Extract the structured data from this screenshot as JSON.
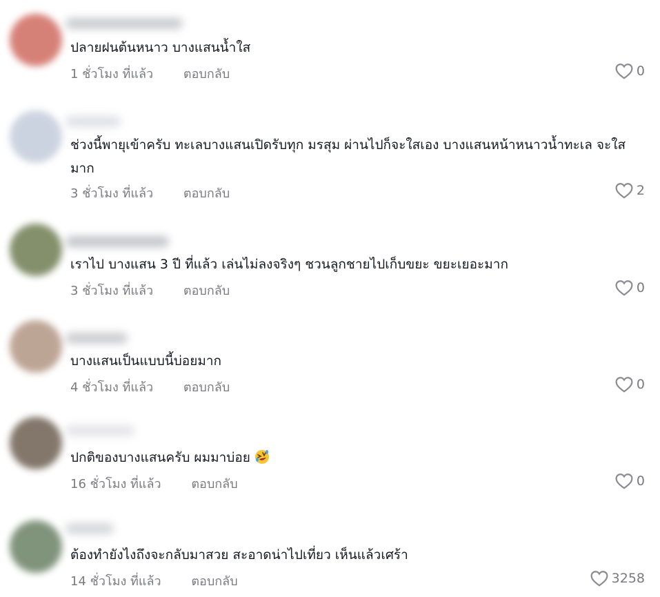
{
  "comments": [
    {
      "text": "ปลายฝนต้นหนาว บางแสนน้ำใส",
      "time": "1 ชั่วโมง ที่แล้ว",
      "reply_label": "ตอบกลับ",
      "likes": "0",
      "avatar_color": "#c9574a"
    },
    {
      "text": "ช่วงนี้พายุเข้าครับ ทะเลบางแสนเปิดรับทุก มรสุม ผ่านไปก็จะใสเอง บางแสนหน้าหนาวน้ำทะเล จะใสมาก",
      "time": "3 ชั่วโมง ที่แล้ว",
      "reply_label": "ตอบกลับ",
      "likes": "2",
      "avatar_color": "#bcc5d6"
    },
    {
      "text": "เราไป บางแสน 3 ปี ที่แล้ว เล่นไม่ลงจริงๆ ชวนลูกชายไปเก็บขยะ ขยะเยอะมาก",
      "time": "3 ชั่วโมง ที่แล้ว",
      "reply_label": "ตอบกลับ",
      "likes": "0",
      "avatar_color": "#5b6b3a"
    },
    {
      "text": "บางแสนเป็นแบบนี้บ่อยมาก",
      "time": "4 ชั่วโมง ที่แล้ว",
      "reply_label": "ตอบกลับ",
      "likes": "0",
      "avatar_color": "#a88772"
    },
    {
      "text": "ปกติของบางแสนครับ ผมมาบ่อย",
      "time": "16 ชั่วโมง ที่แล้ว",
      "reply_label": "ตอบกลับ",
      "likes": "0",
      "avatar_color": "#5a4a3a",
      "emoji": "rolling-on-floor-laughing-emoji"
    },
    {
      "text": "ต้องทำยังไงถึงจะกลับมาสวย สะอาดน่าไปเที่ยว เห็นแล้วเศร้า",
      "time": "14 ชั่วโมง ที่แล้ว",
      "reply_label": "ตอบกลับ",
      "likes": "3258",
      "avatar_color": "#56704f"
    }
  ],
  "icons": {
    "like": "heart-outline-icon"
  },
  "colors": {
    "text": "#161823",
    "muted": "#8a8b91"
  }
}
